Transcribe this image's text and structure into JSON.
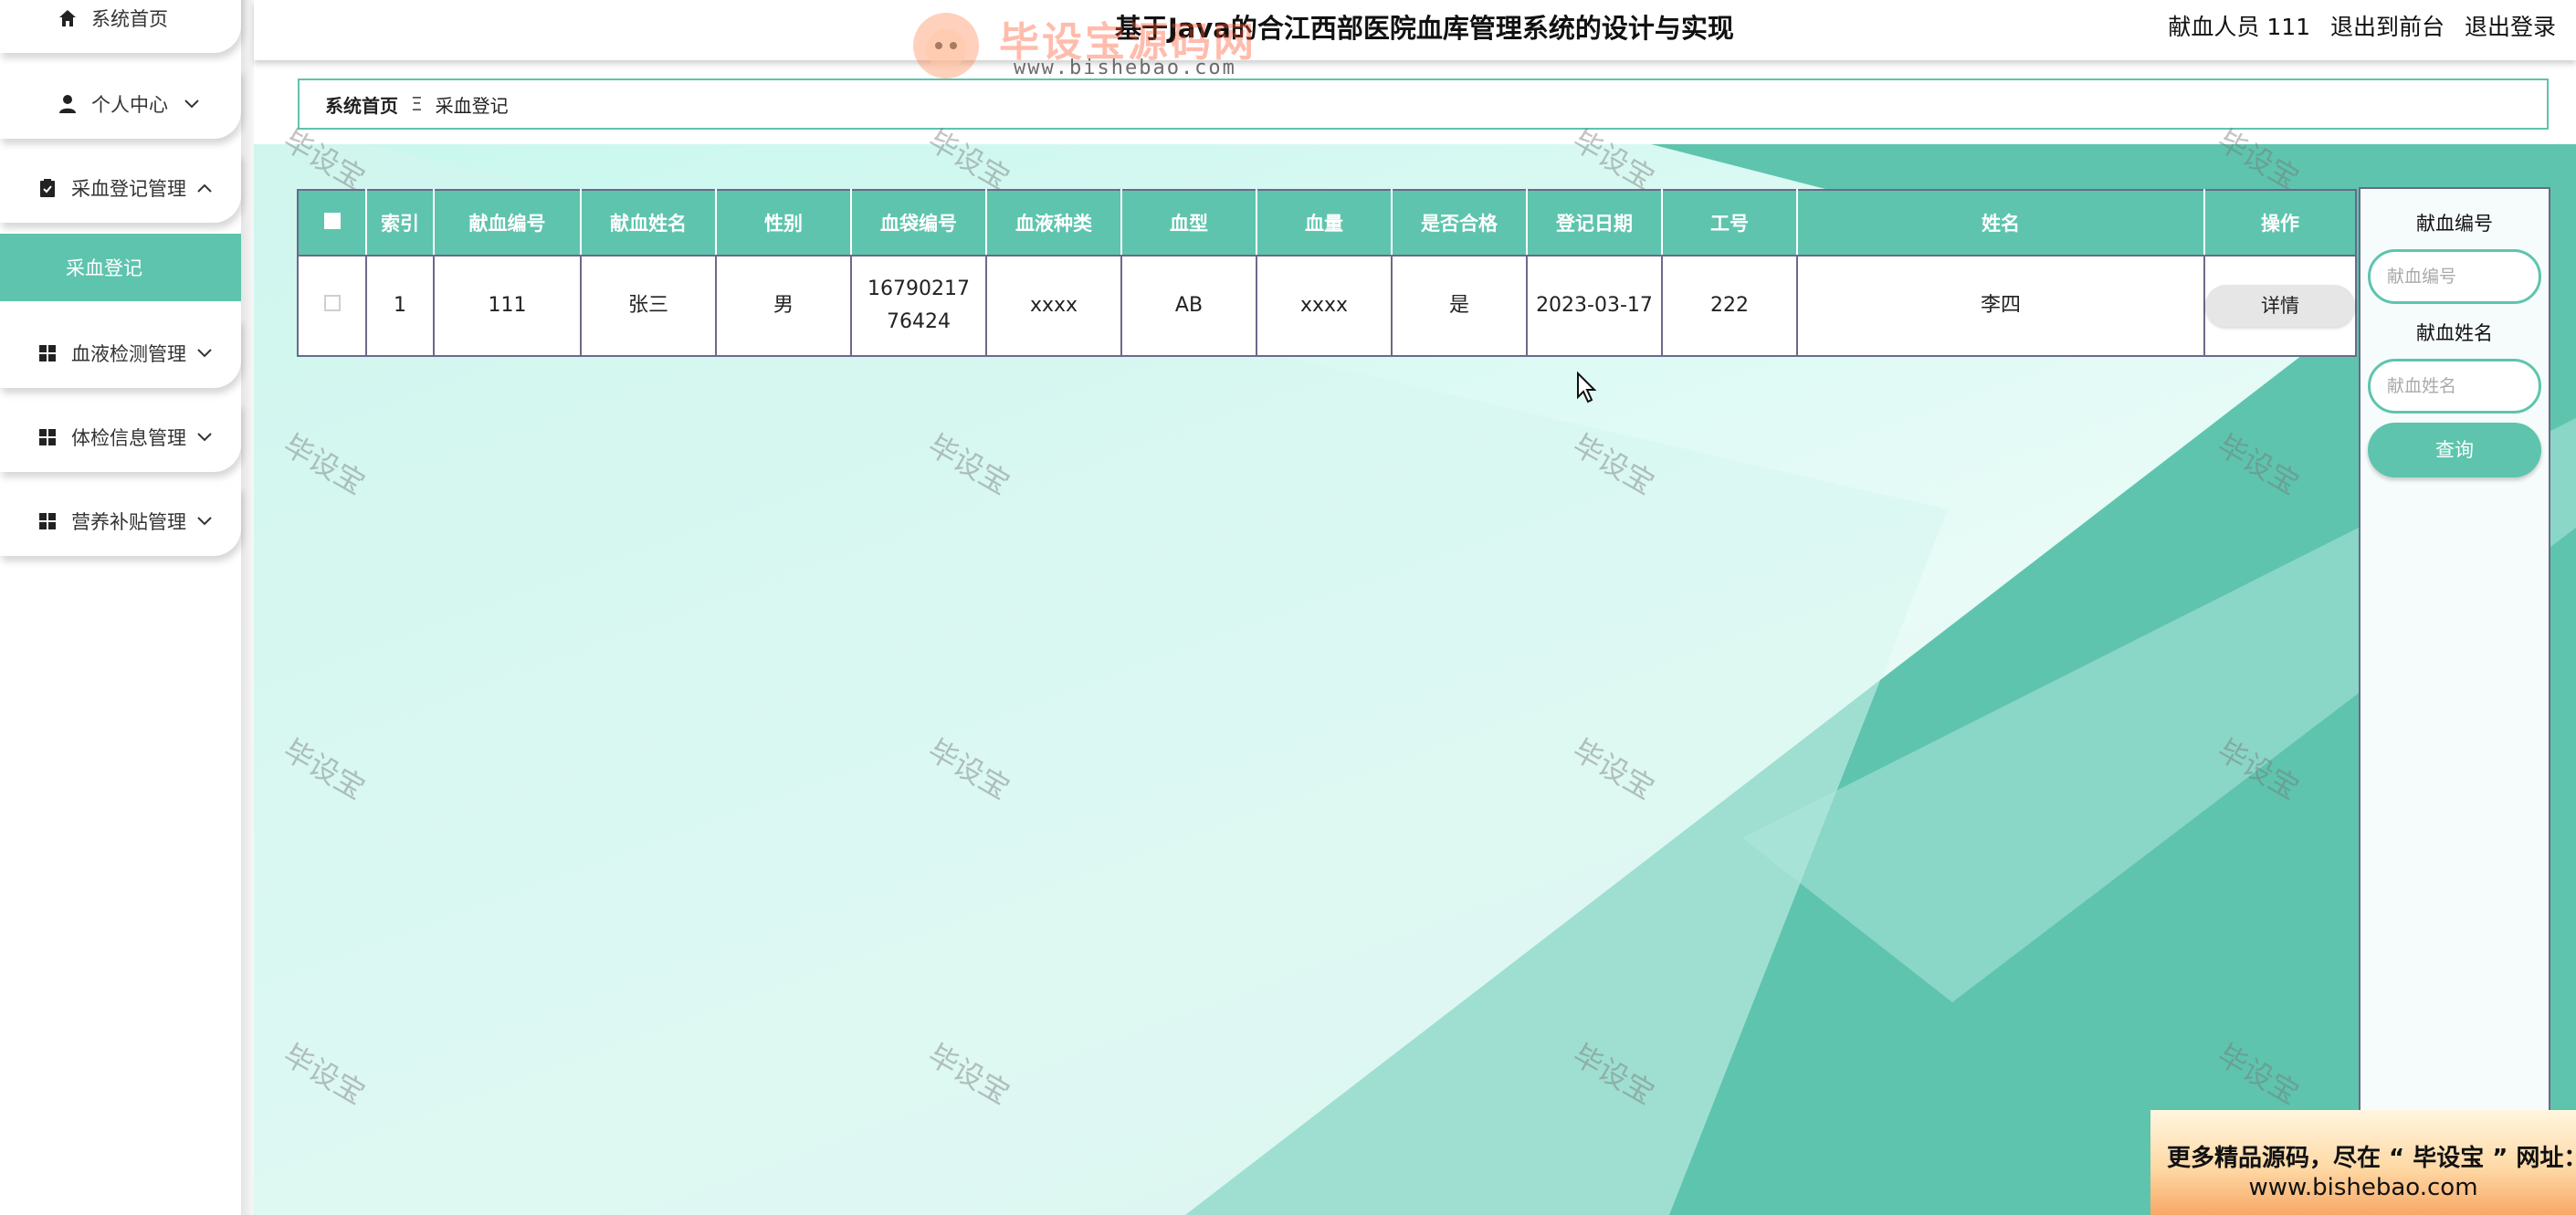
{
  "header": {
    "title": "基于Java的合江西部医院血库管理系统的设计与实现",
    "user_label": "献血人员 111",
    "front_link": "退出到前台",
    "logout_link": "退出登录"
  },
  "watermark": {
    "logo_text": "毕设宝源码网",
    "logo_url": "www.bishebao.com",
    "tile_text": "毕设宝"
  },
  "sidebar": {
    "items": [
      {
        "label": "系统首页",
        "icon": "home-icon"
      },
      {
        "label": "个人中心",
        "icon": "user-icon"
      },
      {
        "label": "采血登记管理",
        "icon": "clipboard-icon"
      },
      {
        "label": "血液检测管理",
        "icon": "grid-icon"
      },
      {
        "label": "体检信息管理",
        "icon": "grid-icon"
      },
      {
        "label": "营养补贴管理",
        "icon": "grid-icon"
      }
    ],
    "active_sub": "采血登记"
  },
  "breadcrumb": {
    "home": "系统首页",
    "separator": "Ξ",
    "current": "采血登记"
  },
  "table": {
    "columns": [
      "索引",
      "献血编号",
      "献血姓名",
      "性别",
      "血袋编号",
      "血液种类",
      "血型",
      "血量",
      "是否合格",
      "登记日期",
      "工号",
      "姓名",
      "操作"
    ],
    "rows": [
      {
        "index": "1",
        "donor_no": "111",
        "donor_name": "张三",
        "gender": "男",
        "bag_no": "1679021776424",
        "blood_kind": "xxxx",
        "blood_type": "AB",
        "volume": "xxxx",
        "qualified": "是",
        "date": "2023-03-17",
        "staff_no": "222",
        "staff_name": "李四",
        "action": "详情"
      }
    ]
  },
  "search": {
    "donor_no_label": "献血编号",
    "donor_no_placeholder": "献血编号",
    "donor_name_label": "献血姓名",
    "donor_name_placeholder": "献血姓名",
    "button": "查询"
  },
  "banner": {
    "line1": "更多精品源码，尽在 “ 毕设宝 ” 网址：",
    "line2": "www.bishebao.com"
  },
  "colors": {
    "accent": "#5ec4ae",
    "content_bg": "#c8f7ee"
  }
}
